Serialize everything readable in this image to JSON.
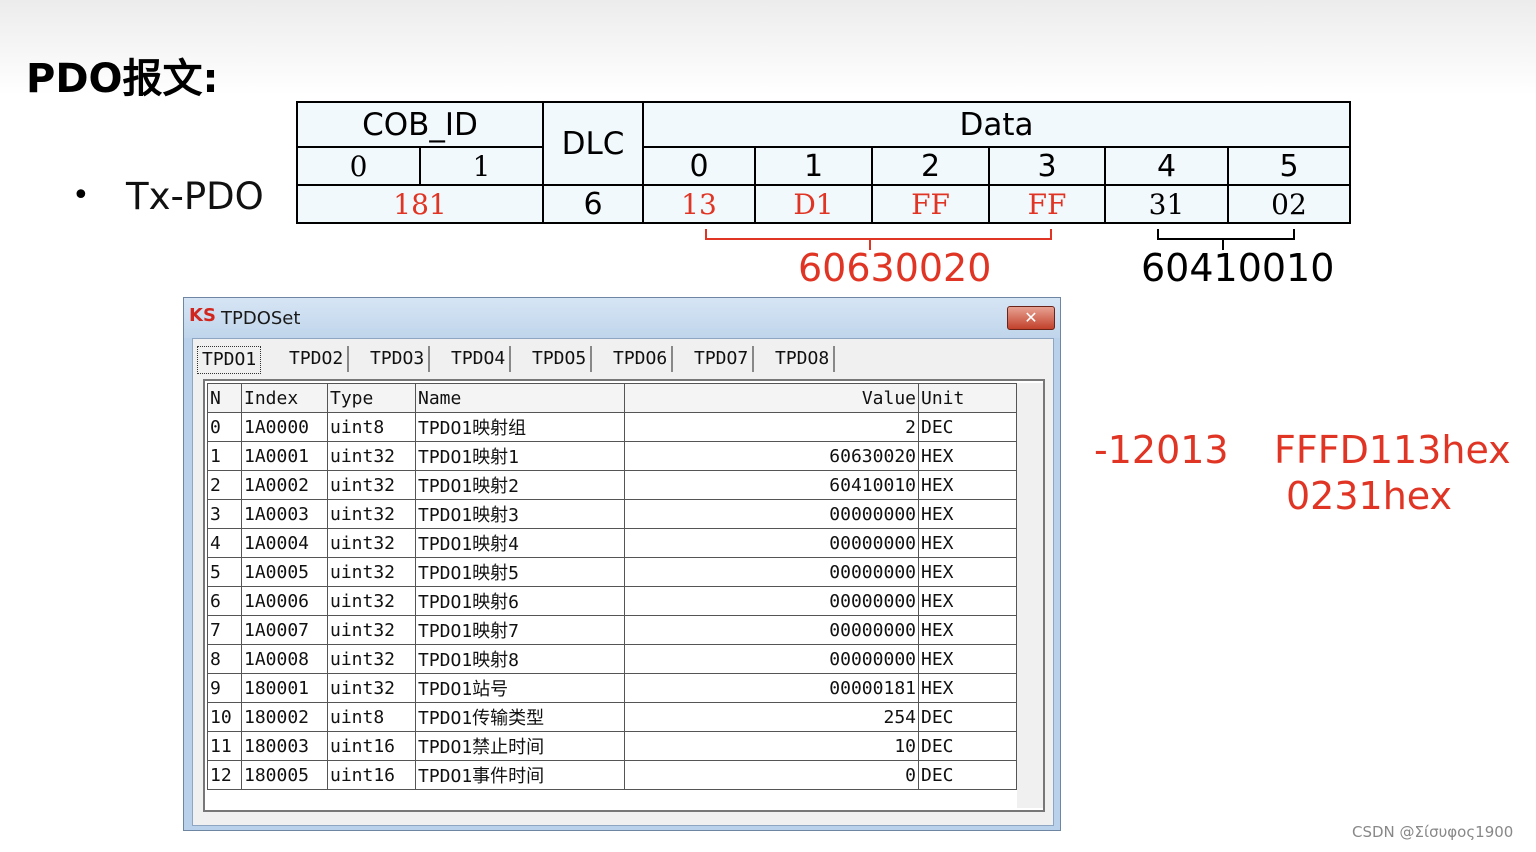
{
  "slide": {
    "title": "PDO报文:",
    "bullet": "•",
    "bullet_text": "Tx-PDO"
  },
  "frame_table": {
    "cob_id_header": "COB_ID",
    "dlc_header": "DLC",
    "data_header": "Data",
    "cob_sub": [
      "0",
      "1"
    ],
    "data_sub": [
      "0",
      "1",
      "2",
      "3",
      "4",
      "5"
    ],
    "cob_value": "181",
    "dlc_value": "6",
    "data_values": [
      "13",
      "D1",
      "FF",
      "FF",
      "31",
      "02"
    ]
  },
  "annotations": {
    "red_group": "60630020",
    "black_group": "60410010",
    "decimal": "-12013",
    "hex1": "FFFD113hex",
    "hex2": "0231hex"
  },
  "window": {
    "icon_text": "KS",
    "title": "TPDOSet",
    "close_label": "✕",
    "tabs": [
      "TPDO1",
      "TPDO2",
      "TPDO3",
      "TPDO4",
      "TPDO5",
      "TPDO6",
      "TPDO7",
      "TPDO8"
    ],
    "columns": [
      "N",
      "Index",
      "Type",
      "Name",
      "Value",
      "Unit"
    ],
    "rows": [
      [
        "0",
        "1A0000",
        "uint8",
        "TPDO1映射组",
        "2",
        "DEC"
      ],
      [
        "1",
        "1A0001",
        "uint32",
        "TPDO1映射1",
        "60630020",
        "HEX"
      ],
      [
        "2",
        "1A0002",
        "uint32",
        "TPDO1映射2",
        "60410010",
        "HEX"
      ],
      [
        "3",
        "1A0003",
        "uint32",
        "TPDO1映射3",
        "00000000",
        "HEX"
      ],
      [
        "4",
        "1A0004",
        "uint32",
        "TPDO1映射4",
        "00000000",
        "HEX"
      ],
      [
        "5",
        "1A0005",
        "uint32",
        "TPDO1映射5",
        "00000000",
        "HEX"
      ],
      [
        "6",
        "1A0006",
        "uint32",
        "TPDO1映射6",
        "00000000",
        "HEX"
      ],
      [
        "7",
        "1A0007",
        "uint32",
        "TPDO1映射7",
        "00000000",
        "HEX"
      ],
      [
        "8",
        "1A0008",
        "uint32",
        "TPDO1映射8",
        "00000000",
        "HEX"
      ],
      [
        "9",
        "180001",
        "uint32",
        "TPDO1站号",
        "00000181",
        "HEX"
      ],
      [
        "10",
        "180002",
        "uint8",
        "TPDO1传输类型",
        "254",
        "DEC"
      ],
      [
        "11",
        "180003",
        "uint16",
        "TPDO1禁止时间",
        "10",
        "DEC"
      ],
      [
        "12",
        "180005",
        "uint16",
        "TPDO1事件时间",
        "0",
        "DEC"
      ]
    ]
  },
  "colors": {
    "accent_red": "#e03524",
    "table_bg": "#f2f9fc",
    "window_frame": "#b9d1ea"
  },
  "watermark": "CSDN @Σίσυφος1900"
}
